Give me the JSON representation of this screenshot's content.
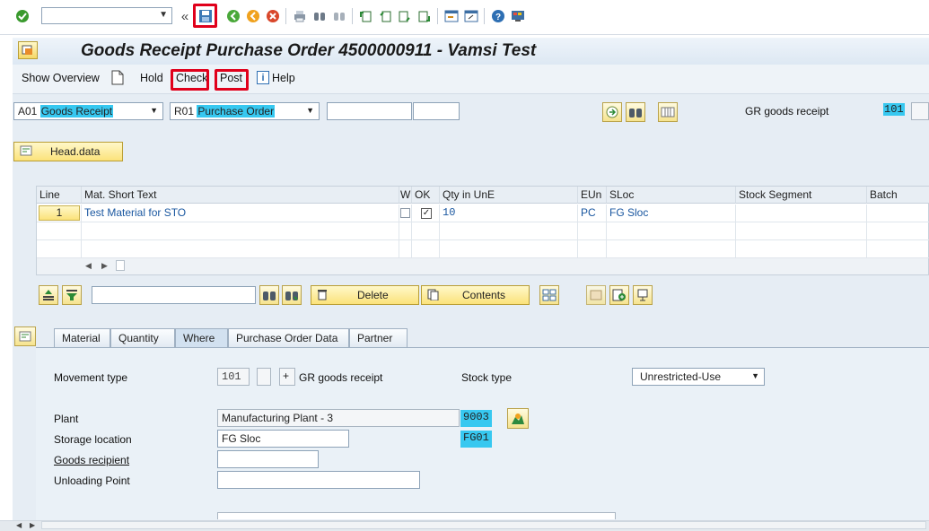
{
  "toolbar": {
    "command_field_value": "",
    "icons": [
      "checkmark-icon",
      "save-icon",
      "back-icon",
      "exit-icon",
      "cancel-icon",
      "print-icon",
      "find-icon",
      "find-next-icon",
      "first-page-icon",
      "previous-page-icon",
      "next-page-icon",
      "last-page-icon",
      "new-session-icon",
      "shortcut-icon",
      "help-icon",
      "customize-layout-icon"
    ]
  },
  "title": "Goods Receipt Purchase Order 4500000911 - Vamsi Test",
  "app_toolbar": {
    "show_overview": "Show Overview",
    "hold": "Hold",
    "check": "Check",
    "post": "Post",
    "help": "Help"
  },
  "header": {
    "action_code": "A01",
    "action_label": "Goods Receipt",
    "ref_code": "R01",
    "ref_label": "Purchase Order",
    "po_value": "",
    "item_value": "",
    "gr_label": "GR goods receipt",
    "movement_type": "101"
  },
  "head_data_button": "Head.data",
  "table": {
    "columns": [
      "Line",
      "Mat. Short Text",
      "W",
      "OK",
      "Qty in UnE",
      "EUn",
      "SLoc",
      "Stock Segment",
      "Batch"
    ],
    "rows": [
      {
        "line": "1",
        "text": "Test Material for STO",
        "ok": true,
        "qty": "10",
        "eun": "PC",
        "sloc": "FG Sloc",
        "segment": "",
        "batch": ""
      }
    ]
  },
  "table_toolbar": {
    "delete": "Delete",
    "contents": "Contents",
    "search_value": ""
  },
  "tabs": [
    "Material",
    "Quantity",
    "Where",
    "Purchase Order Data",
    "Partner"
  ],
  "active_tab": "Where",
  "where": {
    "movement_type_label": "Movement type",
    "movement_type_value": "101",
    "plus": "+",
    "movement_type_text": "GR goods receipt",
    "stock_type_label": "Stock type",
    "stock_type_value": "Unrestricted-Use",
    "plant_label": "Plant",
    "plant_text": "Manufacturing Plant - 3",
    "plant_code": "9003",
    "storage_location_label": "Storage location",
    "storage_location_text": "FG Sloc",
    "storage_location_code": "FG01",
    "goods_recipient_label": "Goods recipient",
    "goods_recipient_value": "",
    "unloading_point_label": "Unloading Point",
    "unloading_point_value": ""
  },
  "colors": {
    "highlight": "#37c8f0",
    "red_box": "#e0001b",
    "button_yellow": "#fbe27a"
  }
}
